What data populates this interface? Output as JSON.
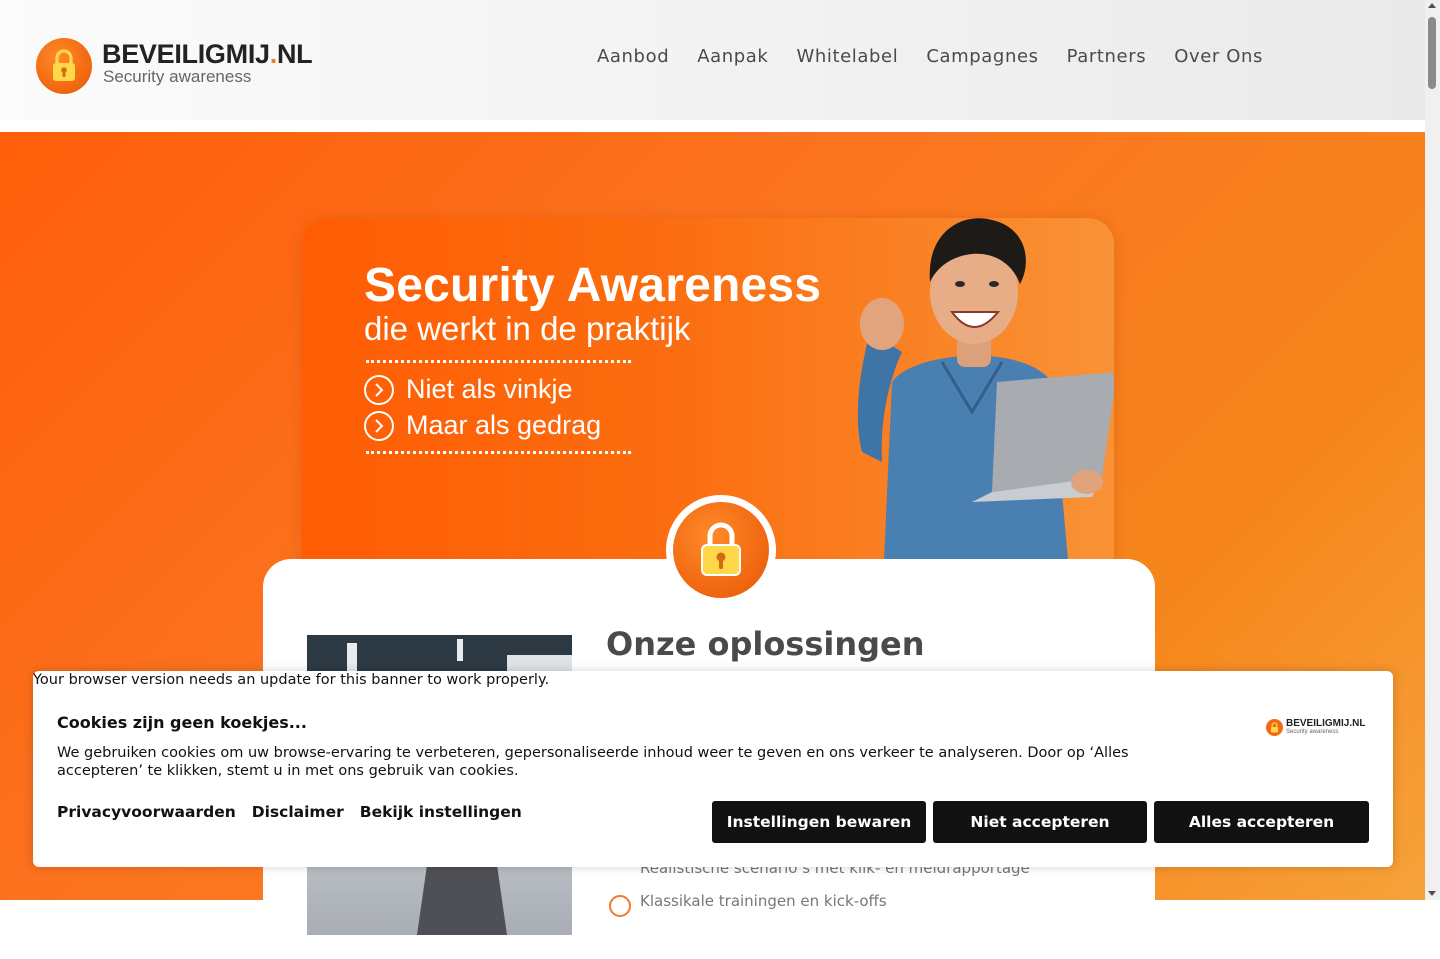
{
  "header": {
    "logo": {
      "title": "BEVEILIGMIJ",
      "dot": ".",
      "tld": "NL",
      "subtitle": "Security awareness",
      "icon": "padlock-icon"
    },
    "nav": [
      "Aanbod",
      "Aanpak",
      "Whitelabel",
      "Campagnes",
      "Partners",
      "Over Ons"
    ]
  },
  "hero": {
    "banner": {
      "title": "Security Awareness",
      "subtitle": "die werkt in de praktijk",
      "bullets": [
        "Niet als vinkje",
        "Maar als gedrag"
      ]
    },
    "card": {
      "title": "Onze oplossingen",
      "partial_lines": [
        "Realistische scenario’s met klik- en meldrapportage",
        "Klassikale trainingen en kick-offs"
      ]
    }
  },
  "cookie_banner": {
    "warning": "Your browser version needs an update for this banner to work properly.",
    "title": "Cookies zijn geen koekjes...",
    "text": "We gebruiken cookies om uw browse-ervaring te verbeteren, gepersonaliseerde inhoud weer te geven en ons verkeer te analyseren. Door op ‘Alles accepteren’ te klikken, stemt u in met ons gebruik van cookies.",
    "links": [
      "Privacyvoorwaarden",
      "Disclaimer",
      "Bekijk instellingen"
    ],
    "buttons": {
      "save": "Instellingen bewaren",
      "reject": "Niet accepteren",
      "accept": "Alles accepteren"
    },
    "logo": {
      "title": "BEVEILIGMIJ.NL",
      "subtitle": "Security awareness"
    }
  },
  "colors": {
    "brand_orange": "#f26a12",
    "hero_orange": "#fb7420",
    "button_black": "#111111"
  }
}
